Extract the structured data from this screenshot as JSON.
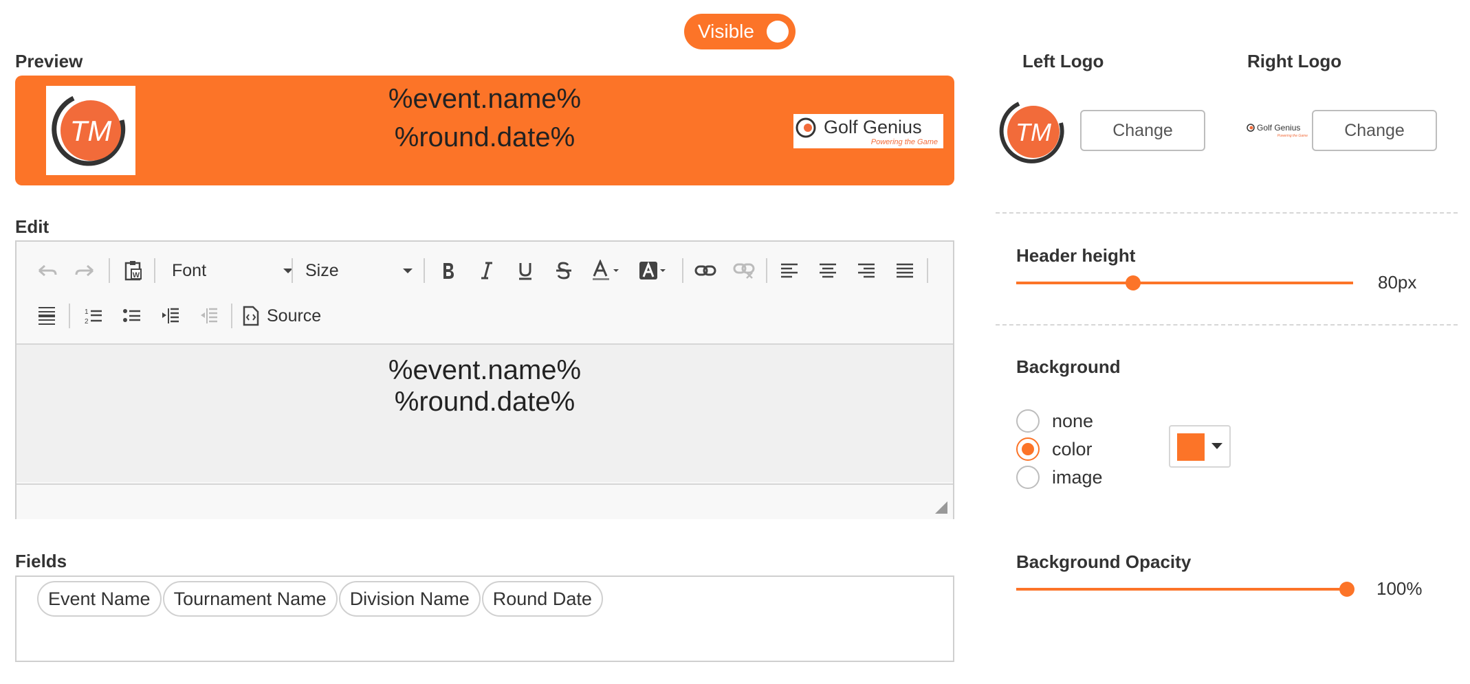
{
  "visibility": {
    "label": "Visible",
    "on": true
  },
  "preview": {
    "label": "Preview",
    "line1": "%event.name%",
    "line2": "%round.date%",
    "left_logo_text": "TM",
    "right_logo_text": "Golf Genius",
    "right_logo_tagline": "Powering the Game"
  },
  "edit": {
    "label": "Edit",
    "toolbar": {
      "font_label": "Font",
      "size_label": "Size",
      "source_label": "Source"
    },
    "content_line1": "%event.name%",
    "content_line2": "%round.date%"
  },
  "fields": {
    "label": "Fields",
    "chips": [
      "Event Name",
      "Tournament Name",
      "Division Name",
      "Round Date"
    ]
  },
  "logos": {
    "left_label": "Left Logo",
    "right_label": "Right Logo",
    "change_label": "Change"
  },
  "header_height": {
    "label": "Header height",
    "value_text": "80px",
    "fraction": 0.34
  },
  "background": {
    "label": "Background",
    "options": [
      "none",
      "color",
      "image"
    ],
    "selected": "color",
    "color": "#fc7428"
  },
  "background_opacity": {
    "label": "Background Opacity",
    "value_text": "100%",
    "fraction": 1.0
  },
  "theme": {
    "accent": "#fc7428"
  }
}
